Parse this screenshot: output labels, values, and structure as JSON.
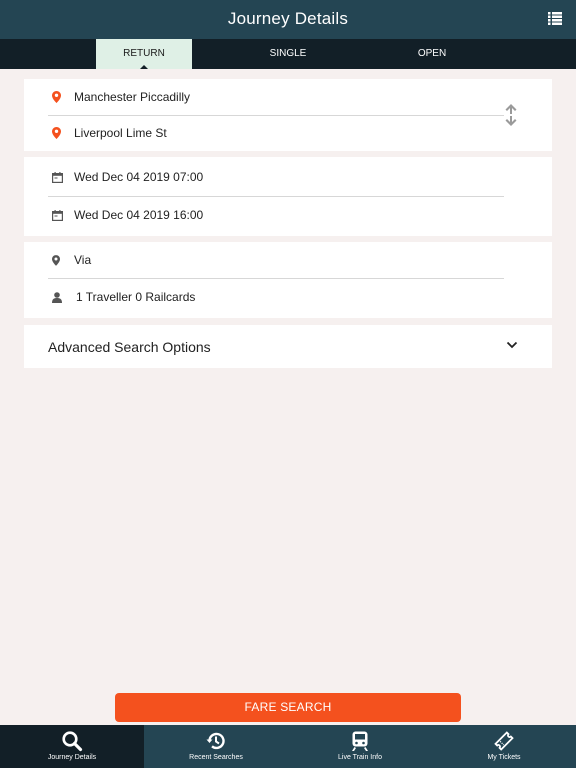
{
  "header": {
    "title": "Journey Details",
    "menu_icon": "list-icon"
  },
  "tabs": [
    {
      "label": "RETURN",
      "active": true
    },
    {
      "label": "SINGLE",
      "active": false
    },
    {
      "label": "OPEN",
      "active": false
    }
  ],
  "stations": {
    "from": "Manchester Piccadilly",
    "to": "Liverpool Lime St",
    "pin_icon": "map-pin-icon",
    "swap_icon": "swap-arrows-icon",
    "pin_color": "#f4511e"
  },
  "dates": {
    "outbound": "Wed Dec 04 2019 07:00",
    "return": "Wed Dec 04 2019 16:00",
    "icon": "calendar-icon"
  },
  "options": {
    "via": "Via",
    "travellers": "1 Traveller 0 Railcards",
    "via_icon": "map-pin-icon",
    "person_icon": "person-icon"
  },
  "advanced": {
    "label": "Advanced Search Options",
    "icon": "chevron-down-icon"
  },
  "fare_search": {
    "label": "FARE SEARCH",
    "color": "#f4511e"
  },
  "bottom_nav": [
    {
      "label": "Journey Details",
      "icon": "search-icon",
      "active": true
    },
    {
      "label": "Recent Searches",
      "icon": "history-icon",
      "active": false
    },
    {
      "label": "Live Train Info",
      "icon": "train-icon",
      "active": false
    },
    {
      "label": "My Tickets",
      "icon": "ticket-icon",
      "active": false
    }
  ],
  "colors": {
    "header": "#244553",
    "tab_bar": "#121f27",
    "active_tab": "#dff0e6",
    "background": "#f6f0ef"
  }
}
